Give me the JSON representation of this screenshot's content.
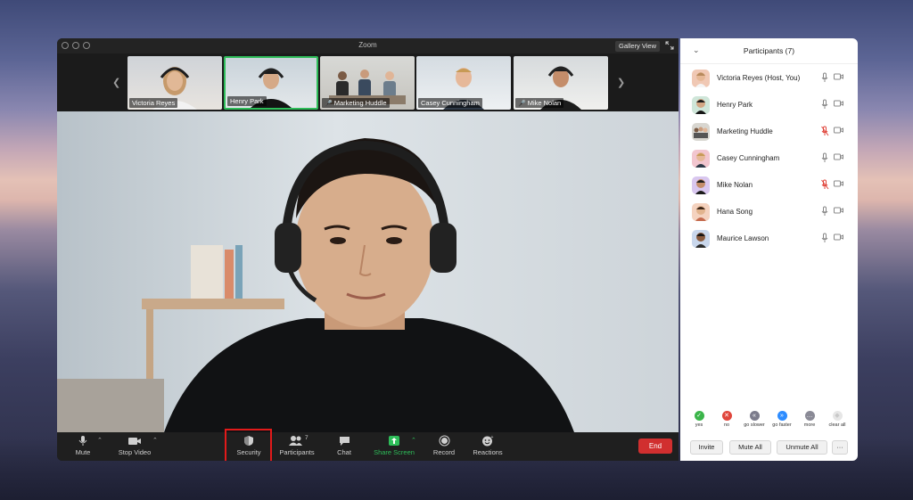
{
  "window": {
    "title": "Zoom",
    "gallery_label": "Gallery View"
  },
  "strip": {
    "thumbs": [
      {
        "name": "Victoria Reyes",
        "muted": false
      },
      {
        "name": "Henry Park",
        "muted": false,
        "active": true
      },
      {
        "name": "Marketing Huddle",
        "muted": true
      },
      {
        "name": "Casey Cunningham",
        "muted": false
      },
      {
        "name": "Mike Nolan",
        "muted": true
      }
    ]
  },
  "toolbar": {
    "mute": "Mute",
    "stop_video": "Stop Video",
    "security": "Security",
    "participants": "Participants",
    "participants_count": "7",
    "chat": "Chat",
    "share_screen": "Share Screen",
    "record": "Record",
    "reactions": "Reactions",
    "end": "End"
  },
  "panel": {
    "title": "Participants (7)",
    "participants": [
      {
        "name": "Victoria Reyes (Host, You)",
        "mic_muted": false
      },
      {
        "name": "Henry Park",
        "mic_muted": false
      },
      {
        "name": "Marketing Huddle",
        "mic_muted": true
      },
      {
        "name": "Casey Cunningham",
        "mic_muted": false
      },
      {
        "name": "Mike Nolan",
        "mic_muted": true
      },
      {
        "name": "Hana Song",
        "mic_muted": false
      },
      {
        "name": "Maurice Lawson",
        "mic_muted": false
      }
    ],
    "reactions": [
      {
        "label": "yes",
        "color": "#3bb54a",
        "glyph": "✓"
      },
      {
        "label": "no",
        "color": "#e0463c",
        "glyph": "✕"
      },
      {
        "label": "go slower",
        "color": "#7c7c8c",
        "glyph": "«"
      },
      {
        "label": "go faster",
        "color": "#2d8cff",
        "glyph": "»"
      },
      {
        "label": "more",
        "color": "#8a8a96",
        "glyph": "…"
      },
      {
        "label": "clear all",
        "color": "#e6e6e6",
        "glyph": "◆"
      }
    ],
    "buttons": {
      "invite": "Invite",
      "mute_all": "Mute All",
      "unmute_all": "Unmute All",
      "more": "···"
    }
  },
  "colors": {
    "accent_green": "#2ebd59",
    "end_red": "#d12f2f",
    "highlight_red": "#e21a1a",
    "muted_red": "#e0463c"
  }
}
